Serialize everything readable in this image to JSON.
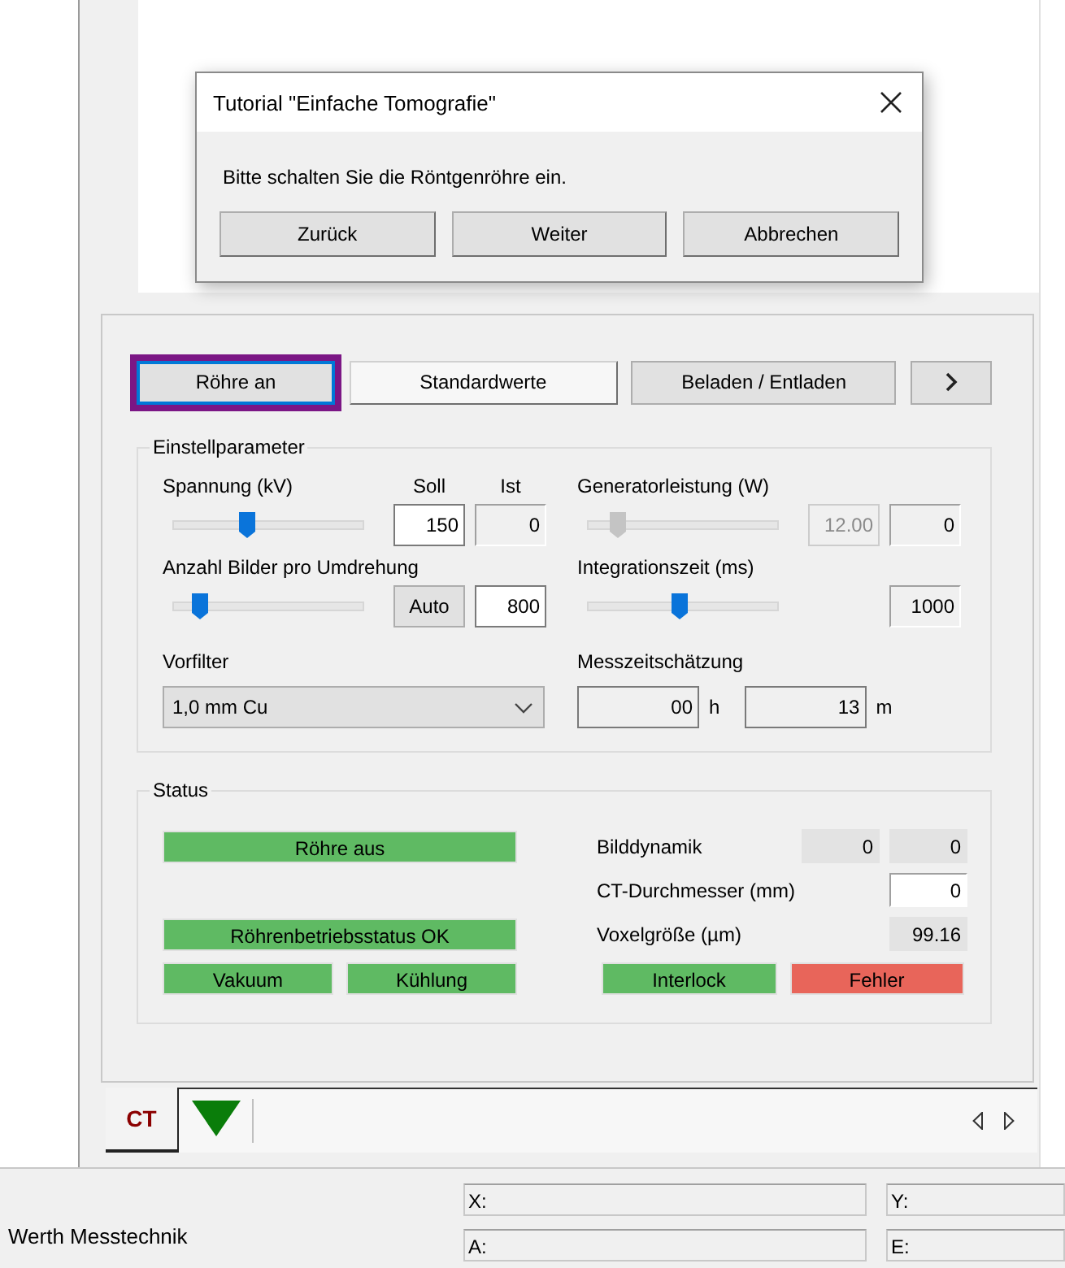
{
  "dialog": {
    "title": "Tutorial \"Einfache Tomografie\"",
    "message": "Bitte schalten Sie die Röntgenröhre ein.",
    "buttons": [
      "Zurück",
      "Weiter",
      "Abbrechen"
    ]
  },
  "toolbar": [
    {
      "kind": "text",
      "label": "Röhre an",
      "highlighted": true
    },
    {
      "kind": "text",
      "label": "Standardwerte",
      "highlighted": false
    },
    {
      "kind": "text",
      "label": "Beladen / Entladen",
      "highlighted": false
    },
    {
      "kind": "next",
      "highlighted": false
    }
  ],
  "settings": {
    "title": "Einstellparameter",
    "voltage": {
      "label": "Spannung (kV)",
      "target_heading": "Soll",
      "actual_heading": "Ist",
      "disabled": false,
      "level": 0.39,
      "target": "150",
      "actual": "0"
    },
    "power": {
      "label": "Generatorleistung (W)",
      "disabled": true,
      "level": 0.16,
      "target": "12.00",
      "actual": "0"
    },
    "images": {
      "label": "Anzahl Bilder pro Umdrehung",
      "disabled": false,
      "level": 0.14,
      "auto": "Auto",
      "value": "800"
    },
    "integration": {
      "label": "Integrationszeit (ms)",
      "disabled": false,
      "level": 0.48,
      "value": "1000"
    },
    "prefilter": {
      "label": "Vorfilter",
      "value": "1,0 mm Cu"
    },
    "time_estimate": {
      "label": "Messzeitschätzung",
      "hours": "00",
      "hours_unit": "h",
      "minutes": "13",
      "minutes_unit": "m"
    }
  },
  "status": {
    "title": "Status",
    "tube": {
      "label": "Röhre aus",
      "color": "#5fba63"
    },
    "tube_status": {
      "label": "Röhrenbetriebsstatus OK",
      "color": "#5fba63"
    },
    "vacuum": {
      "label": "Vakuum",
      "color": "#5fba63"
    },
    "cooling": {
      "label": "Kühlung",
      "color": "#5fba63"
    },
    "interlock": {
      "label": "Interlock",
      "color": "#5fba63"
    },
    "error": {
      "label": "Fehler",
      "color": "#e8655a"
    },
    "image_dynamics": {
      "label": "Bilddynamik",
      "values": [
        "0",
        "0"
      ]
    },
    "ct_diameter": {
      "label": "CT-Durchmesser (mm)",
      "value": "0"
    },
    "voxel_size": {
      "label": "Voxelgröße (µm)",
      "value": "99.16"
    }
  },
  "tabs": [
    {
      "kind": "text",
      "label": "CT",
      "selected": true
    },
    {
      "kind": "triangle",
      "selected": false
    }
  ],
  "status_bar": {
    "company": "Werth Messtechnik",
    "fields": [
      "X:",
      "Y:",
      "A:",
      "E:"
    ]
  }
}
